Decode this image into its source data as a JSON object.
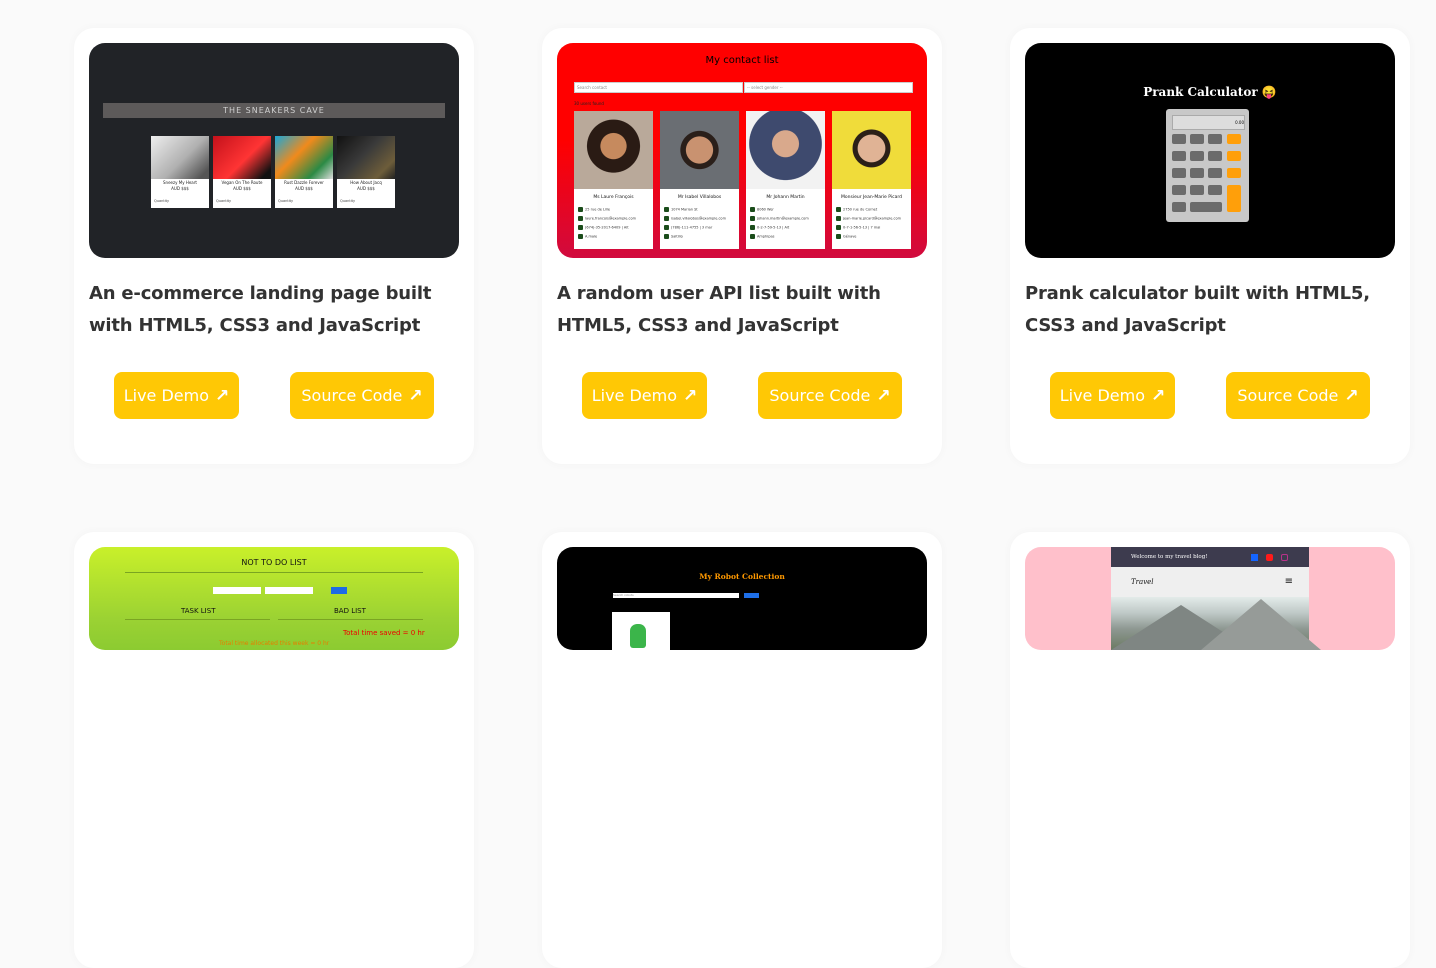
{
  "projects": [
    {
      "title": "An e-commerce landing page built with HTML5, CSS3 and JavaScript",
      "live_label": "Live Demo",
      "source_label": "Source Code",
      "preview": {
        "banner": "THE SNEAKERS CAVE",
        "products": [
          {
            "name": "Sneezy My Heart",
            "price": "AUD $$$",
            "button": "Quantity"
          },
          {
            "name": "Vegan On The Route",
            "price": "AUD $$$",
            "button": "Quantity"
          },
          {
            "name": "Rust Dazzle Forever",
            "price": "AUD $$$",
            "button": "Quantity"
          },
          {
            "name": "How About Jacq",
            "price": "AUD $$$",
            "button": "Quantity"
          }
        ]
      }
    },
    {
      "title": "A random user API list built with HTML5, CSS3 and JavaScript",
      "live_label": "Live Demo",
      "source_label": "Source Code",
      "preview": {
        "heading": "My contact list",
        "search_placeholder": "Search contact",
        "gender_select": "-- select gender --",
        "results": "30 users found",
        "contacts": [
          {
            "name": "Ms Laure François",
            "lines": [
              "25 rue de Lille",
              "laure.francois@example.com",
              "(674)-35-2017-6409 | Alt",
              "A.male"
            ]
          },
          {
            "name": "Mr Isabel Villalobos",
            "lines": [
              "1074 Marian St",
              "isabel.villalobos@example.com",
              "(786)-111-4755 | 3 mar",
              "Saltillo"
            ]
          },
          {
            "name": "Mr Johann Martin",
            "lines": [
              "8060 Wer",
              "johann.martin@example.com",
              "0-2-7-59-5-13 | Alt",
              "Amphipas"
            ]
          },
          {
            "name": "Monsieur Jean-Marie Picard",
            "lines": [
              "2750 rue du Cornet",
              "jean-marie.picard@example.com",
              "0-7-1-56-5-13 | 7 mai",
              "Génave"
            ]
          }
        ]
      }
    },
    {
      "title": "Prank calculator built with HTML5, CSS3 and JavaScript",
      "live_label": "Live Demo",
      "source_label": "Source Code",
      "preview": {
        "heading": "Prank Calculator 😝",
        "display": "0.00"
      }
    },
    {
      "preview": {
        "heading": "NOT TO DO LIST",
        "task_label": "TASK LIST",
        "bad_label": "BAD LIST",
        "saved": "Total time saved = 0 hr",
        "allocated": "Total time allocated this week = 0 hr"
      }
    },
    {
      "preview": {
        "heading": "My Robot Collection",
        "search_placeholder": "Search robots"
      }
    },
    {
      "preview": {
        "welcome": "Welcome to my travel blog!",
        "brand": "Travel"
      }
    }
  ],
  "colors": {
    "button": "#ffc805",
    "page_bg": "#fafafa",
    "card_bg": "#ffffff",
    "title": "#333333"
  },
  "icons": {
    "external_link": "arrow-up-right-icon"
  }
}
